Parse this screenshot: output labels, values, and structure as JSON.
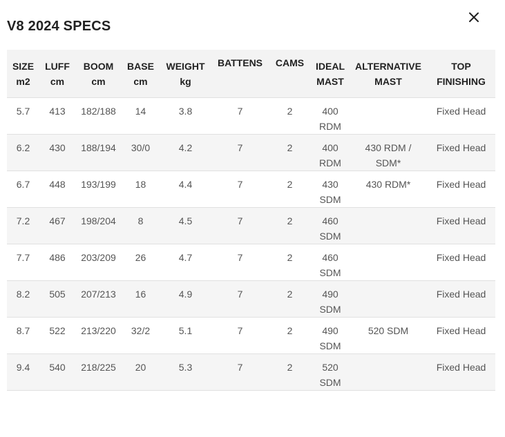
{
  "modal": {
    "title": "V8 2024 SPECS",
    "close_icon": "close-icon"
  },
  "table": {
    "headers": [
      {
        "line1": "SIZE",
        "line2": "m2"
      },
      {
        "line1": "LUFF",
        "line2": "cm"
      },
      {
        "line1": "BOOM",
        "line2": "cm"
      },
      {
        "line1": "BASE",
        "line2": "cm"
      },
      {
        "line1": "WEIGHT",
        "line2": "kg"
      },
      {
        "line1": "BATTENS",
        "line2": ""
      },
      {
        "line1": "CAMS",
        "line2": ""
      },
      {
        "line1": "IDEAL",
        "line2": "MAST"
      },
      {
        "line1": "ALTERNATIVE",
        "line2": "MAST"
      },
      {
        "line1": "TOP",
        "line2": "FINISHING"
      }
    ],
    "rows": [
      {
        "size": "5.7",
        "luff": "413",
        "boom": "182/188",
        "base": "14",
        "weight": "3.8",
        "battens": "7",
        "cams": "2",
        "ideal_mast_1": "400",
        "ideal_mast_2": "RDM",
        "alt_mast_1": "",
        "alt_mast_2": "",
        "top": "Fixed Head"
      },
      {
        "size": "6.2",
        "luff": "430",
        "boom": "188/194",
        "base": "30/0",
        "weight": "4.2",
        "battens": "7",
        "cams": "2",
        "ideal_mast_1": "400",
        "ideal_mast_2": "RDM",
        "alt_mast_1": "430 RDM /",
        "alt_mast_2": "SDM*",
        "top": "Fixed Head"
      },
      {
        "size": "6.7",
        "luff": "448",
        "boom": "193/199",
        "base": "18",
        "weight": "4.4",
        "battens": "7",
        "cams": "2",
        "ideal_mast_1": "430",
        "ideal_mast_2": "SDM",
        "alt_mast_1": "430 RDM*",
        "alt_mast_2": "",
        "top": "Fixed Head"
      },
      {
        "size": "7.2",
        "luff": "467",
        "boom": "198/204",
        "base": "8",
        "weight": "4.5",
        "battens": "7",
        "cams": "2",
        "ideal_mast_1": "460",
        "ideal_mast_2": "SDM",
        "alt_mast_1": "",
        "alt_mast_2": "",
        "top": "Fixed Head"
      },
      {
        "size": "7.7",
        "luff": "486",
        "boom": "203/209",
        "base": "26",
        "weight": "4.7",
        "battens": "7",
        "cams": "2",
        "ideal_mast_1": "460",
        "ideal_mast_2": "SDM",
        "alt_mast_1": "",
        "alt_mast_2": "",
        "top": "Fixed Head"
      },
      {
        "size": "8.2",
        "luff": "505",
        "boom": "207/213",
        "base": "16",
        "weight": "4.9",
        "battens": "7",
        "cams": "2",
        "ideal_mast_1": "490",
        "ideal_mast_2": "SDM",
        "alt_mast_1": "",
        "alt_mast_2": "",
        "top": "Fixed Head"
      },
      {
        "size": "8.7",
        "luff": "522",
        "boom": "213/220",
        "base": "32/2",
        "weight": "5.1",
        "battens": "7",
        "cams": "2",
        "ideal_mast_1": "490",
        "ideal_mast_2": "SDM",
        "alt_mast_1": "520 SDM",
        "alt_mast_2": "",
        "top": "Fixed Head"
      },
      {
        "size": "9.4",
        "luff": "540",
        "boom": "218/225",
        "base": "20",
        "weight": "5.3",
        "battens": "7",
        "cams": "2",
        "ideal_mast_1": "520",
        "ideal_mast_2": "SDM",
        "alt_mast_1": "",
        "alt_mast_2": "",
        "top": "Fixed Head"
      }
    ]
  },
  "colors": {
    "title": "#222222",
    "text": "#555555",
    "header_bg": "#f3f3f3",
    "stripe_bg": "#f5f5f5",
    "border": "#e0e0e0"
  }
}
